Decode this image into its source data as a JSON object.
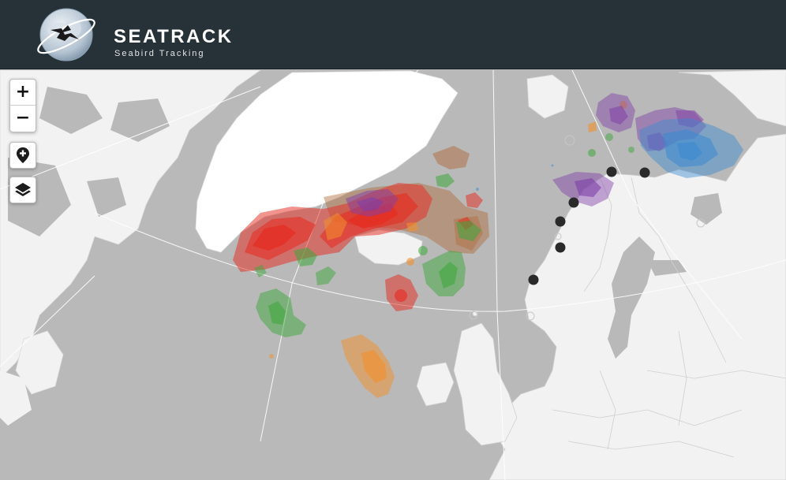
{
  "header": {
    "title": "SEATRACK",
    "subtitle": "Seabird Tracking",
    "background": "#263238"
  },
  "controls": {
    "zoom_in_label": "+",
    "zoom_out_label": "−",
    "locate_icon": "map-pin-plus-icon",
    "layers_icon": "layers-icon"
  },
  "map": {
    "land_color": "#f4f4f4",
    "sea_color": "#b9b9b9",
    "greenland_color": "#ffffff",
    "layers": [
      {
        "name": "red",
        "color": "#e8281e"
      },
      {
        "name": "orange",
        "color": "#f39029"
      },
      {
        "name": "green",
        "color": "#3ea83b"
      },
      {
        "name": "brown",
        "color": "#b06a3c"
      },
      {
        "name": "purple",
        "color": "#7f3fa8"
      },
      {
        "name": "blue",
        "color": "#3a8ad0"
      }
    ],
    "colony_marker_color": "#2a2a2a"
  }
}
